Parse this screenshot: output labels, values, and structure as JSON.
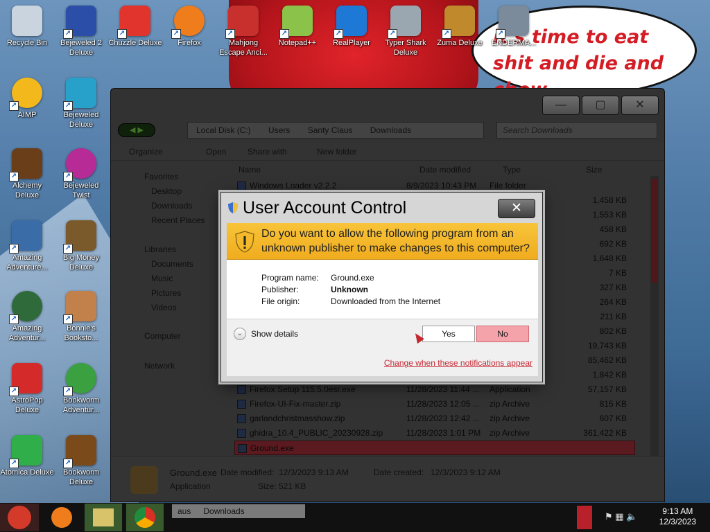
{
  "wallpaper": {
    "speech_text": "it's time to eat shit and die and chew"
  },
  "desktop_icons": [
    {
      "label": "Recycle Bin",
      "color": "#c9d4df"
    },
    {
      "label": "Bejeweled 2 Deluxe",
      "color": "#2b4fa8"
    },
    {
      "label": "Chuzzle Deluxe",
      "color": "#e0342c"
    },
    {
      "label": "Firefox",
      "color": "#f07d1b"
    },
    {
      "label": "Mahjong Escape Anci...",
      "color": "#c7302c"
    },
    {
      "label": "Notepad++",
      "color": "#8bc34a"
    },
    {
      "label": "RealPlayer",
      "color": "#1e79d6"
    },
    {
      "label": "Typer Shark Deluxe",
      "color": "#9aa6b0"
    },
    {
      "label": "Zuma Deluxe",
      "color": "#c08a2c"
    },
    {
      "label": "ENDERMA...",
      "color": "#7b8b9b"
    },
    {
      "label": "AIMP",
      "color": "#f3b81c"
    },
    {
      "label": "Bejeweled Deluxe",
      "color": "#27a1c9"
    },
    {
      "label": "Alchemy Deluxe",
      "color": "#6b3e1a"
    },
    {
      "label": "Bejeweled Twist",
      "color": "#b62b96"
    },
    {
      "label": "Amazing Adventure...",
      "color": "#3a6ca8"
    },
    {
      "label": "Big Money Deluxe",
      "color": "#7a5a2a"
    },
    {
      "label": "Amazing Adventur...",
      "color": "#2f6a3a"
    },
    {
      "label": "Bonnie's Booksto...",
      "color": "#c2804a"
    },
    {
      "label": "AstroPop Deluxe",
      "color": "#d52a2a"
    },
    {
      "label": "Bookworm Adventur...",
      "color": "#3aa040"
    },
    {
      "label": "Atomica Deluxe",
      "color": "#2fae4a"
    },
    {
      "label": "Bookworm Deluxe",
      "color": "#7a4a1a"
    }
  ],
  "explorer": {
    "breadcrumb": [
      "Local Disk (C:)",
      "Users",
      "Santy Claus",
      "Downloads"
    ],
    "search_placeholder": "Search Downloads",
    "toolbar": {
      "organize": "Organize",
      "open": "Open",
      "share_with": "Share with",
      "new_folder": "New folder"
    },
    "nav": {
      "favorites": "Favorites",
      "desktop": "Desktop",
      "downloads": "Downloads",
      "recent": "Recent Places",
      "libraries": "Libraries",
      "documents": "Documents",
      "music": "Music",
      "pictures": "Pictures",
      "videos": "Videos",
      "computer": "Computer",
      "network": "Network"
    },
    "columns": {
      "name": "Name",
      "date": "Date modified",
      "type": "Type",
      "size": "Size"
    },
    "files": [
      {
        "name": "Windows Loader v2.2.2",
        "date": "8/9/2023 10:43 PM",
        "type": "File folder",
        "size": ""
      },
      {
        "name": "",
        "date": "",
        "type": "",
        "size": "1,458 KB"
      },
      {
        "name": "",
        "date": "",
        "type": "",
        "size": "1,553 KB"
      },
      {
        "name": "",
        "date": "",
        "type": "",
        "size": "458 KB"
      },
      {
        "name": "",
        "date": "",
        "type": "",
        "size": "692 KB"
      },
      {
        "name": "",
        "date": "",
        "type": "",
        "size": "1,648 KB"
      },
      {
        "name": "",
        "date": "",
        "type": "",
        "size": "7 KB"
      },
      {
        "name": "",
        "date": "",
        "type": "",
        "size": "327 KB"
      },
      {
        "name": "",
        "date": "",
        "type": "",
        "size": "264 KB"
      },
      {
        "name": "",
        "date": "",
        "type": "",
        "size": "211 KB"
      },
      {
        "name": "",
        "date": "",
        "type": "",
        "size": "802 KB"
      },
      {
        "name": "",
        "date": "",
        "type": "",
        "size": "19,743 KB"
      },
      {
        "name": "",
        "date": "",
        "type": "",
        "size": "85,462 KB"
      },
      {
        "name": "",
        "date": "",
        "type": "",
        "size": "1,842 KB"
      },
      {
        "name": "Firefox Setup 115.5.0esr.exe",
        "date": "11/28/2023 11:44 ...",
        "type": "Application",
        "size": "57,157 KB"
      },
      {
        "name": "Firefox-UI-Fix-master.zip",
        "date": "11/28/2023 12:05 ...",
        "type": "zip Archive",
        "size": "815 KB"
      },
      {
        "name": "garlandchristmasshow.zip",
        "date": "11/28/2023 12:42 ...",
        "type": "zip Archive",
        "size": "607 KB"
      },
      {
        "name": "ghidra_10.4_PUBLIC_20230928.zip",
        "date": "11/28/2023 1:01 PM",
        "type": "zip Archive",
        "size": "361,422 KB"
      },
      {
        "name": "Ground.exe",
        "date": "",
        "type": "",
        "size": ""
      }
    ],
    "details": {
      "filename": "Ground.exe",
      "filetype": "Application",
      "modified_label": "Date modified:",
      "modified_value": "12/3/2023 9:13 AM",
      "created_label": "Date created:",
      "created_value": "12/3/2023 9:12 AM",
      "size_label": "Size:",
      "size_value": "521 KB"
    }
  },
  "uac": {
    "title": "User Account Control",
    "question": "Do you want to allow the following program from an unknown publisher to make changes to this computer?",
    "program_label": "Program name:",
    "program_value": "Ground.exe",
    "publisher_label": "Publisher:",
    "publisher_value": "Unknown",
    "origin_label": "File origin:",
    "origin_value": "Downloaded from the Internet",
    "show_details": "Show details",
    "yes": "Yes",
    "no": "No",
    "change_link": "Change when these notifications appear"
  },
  "taskbar": {
    "task_label1": "aus",
    "task_label2": "Downloads",
    "time": "9:13 AM",
    "date": "12/3/2023"
  }
}
